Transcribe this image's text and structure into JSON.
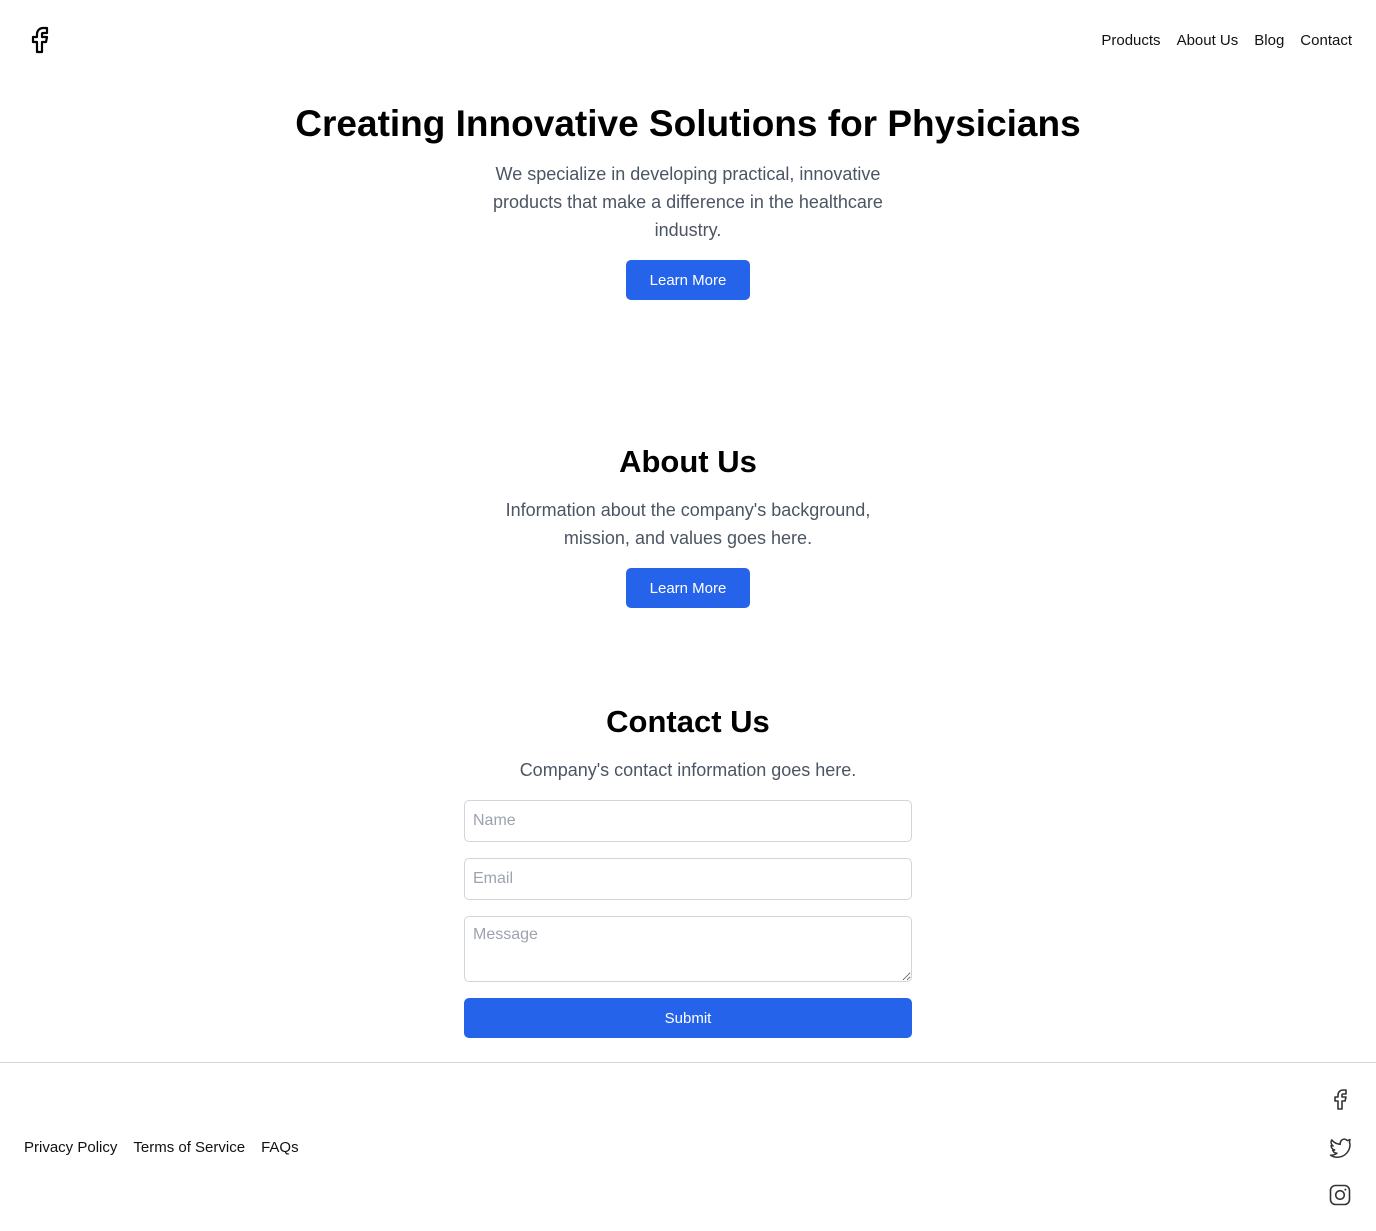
{
  "header": {
    "logo_icon": "facebook-icon",
    "nav": [
      {
        "label": "Products"
      },
      {
        "label": "About Us"
      },
      {
        "label": "Blog"
      },
      {
        "label": "Contact"
      }
    ]
  },
  "hero": {
    "title": "Creating Innovative Solutions for Physicians",
    "text": "We specialize in developing practical, innovative products that make a difference in the healthcare industry.",
    "button_label": "Learn More"
  },
  "about": {
    "title": "About Us",
    "text": "Information about the company's background, mission, and values goes here.",
    "button_label": "Learn More"
  },
  "contact": {
    "title": "Contact Us",
    "text": "Company's contact information goes here.",
    "name_placeholder": "Name",
    "email_placeholder": "Email",
    "message_placeholder": "Message",
    "submit_label": "Submit"
  },
  "footer": {
    "links": [
      {
        "label": "Privacy Policy"
      },
      {
        "label": "Terms of Service"
      },
      {
        "label": "FAQs"
      }
    ],
    "social_icons": [
      "facebook-icon",
      "twitter-icon",
      "instagram-icon"
    ]
  },
  "colors": {
    "accent": "#2563eb",
    "body_text": "#4b5563",
    "border": "#d1d5db"
  }
}
